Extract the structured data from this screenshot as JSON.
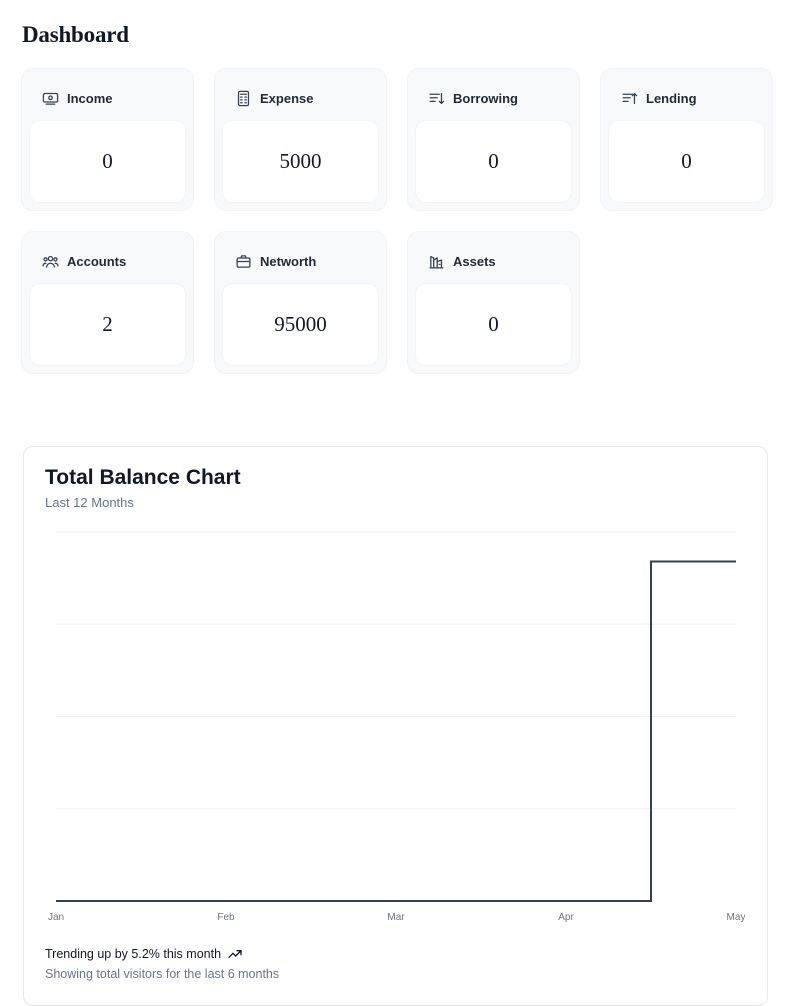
{
  "page": {
    "title": "Dashboard"
  },
  "stats": [
    {
      "label": "Income",
      "value": "0",
      "icon": "income-icon"
    },
    {
      "label": "Expense",
      "value": "5000",
      "icon": "expense-icon"
    },
    {
      "label": "Borrowing",
      "value": "0",
      "icon": "borrowing-icon"
    },
    {
      "label": "Lending",
      "value": "0",
      "icon": "lending-icon"
    },
    {
      "label": "Accounts",
      "value": "2",
      "icon": "accounts-icon"
    },
    {
      "label": "Networth",
      "value": "95000",
      "icon": "networth-icon"
    },
    {
      "label": "Assets",
      "value": "0",
      "icon": "assets-icon"
    }
  ],
  "chart_card": {
    "title": "Total Balance Chart",
    "subtitle": "Last 12 Months",
    "trend_text": "Trending up by 5.2% this month",
    "trend_icon": "trending-up-icon",
    "footer_note": "Showing total visitors for the last 6 months"
  },
  "chart_data": {
    "type": "line",
    "interpolation": "step",
    "x": [
      "Jan",
      "Feb",
      "Mar",
      "Apr",
      "May"
    ],
    "series": [
      {
        "values": [
          0,
          0,
          0,
          0,
          92000
        ],
        "step_change_at": 3.5
      }
    ],
    "ylim": [
      0,
      100000
    ],
    "grid": true,
    "line_color": "#334155",
    "grid_color": "#eef0f3"
  },
  "colors": {
    "card_bg": "#f8f9fb",
    "muted_text": "#64748b",
    "line": "#334155"
  }
}
